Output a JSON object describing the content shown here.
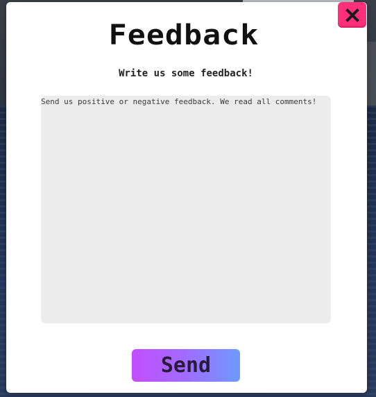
{
  "modal": {
    "title": "Feedback",
    "subtitle": "Write us some feedback!"
  },
  "feedback": {
    "placeholder": "Send us positive or negative feedback. We read all comments!",
    "value": ""
  },
  "actions": {
    "send_label": "Send",
    "close_icon": "close-icon"
  },
  "colors": {
    "close_button": "#ff2f7a",
    "send_gradient_start": "#c44dff",
    "send_gradient_end": "#6d9bff",
    "textarea_bg": "#ececec"
  }
}
